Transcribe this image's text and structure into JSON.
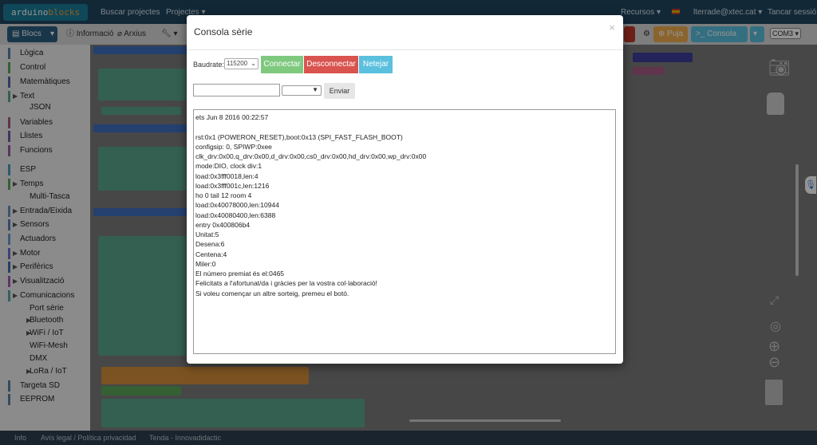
{
  "navbar": {
    "logo_a": "arduino",
    "logo_b": "blocks",
    "links": [
      "Buscar projectes",
      "Projectes ▾"
    ],
    "right": [
      "Recursos ▾",
      "lterrade@xtec.cat ▾",
      "Tancar sessió"
    ]
  },
  "toolbar": {
    "blocs": "Blocs",
    "info": "Informació",
    "arxius": "Arxius",
    "puja": "Puja",
    "consola": "Consola",
    "port": "COM3"
  },
  "categories": [
    {
      "label": "Lògica",
      "color": "#5b80a5",
      "arrow": false
    },
    {
      "label": "Control",
      "color": "#5ba55b",
      "arrow": false
    },
    {
      "label": "Matemàtiques",
      "color": "#5b67a5",
      "arrow": false
    },
    {
      "label": "Text",
      "color": "#5ba58c",
      "arrow": true
    },
    {
      "label": "JSON",
      "color": "",
      "arrow": false,
      "indent": true
    },
    {
      "label": "Variables",
      "color": "#a55b80",
      "arrow": false
    },
    {
      "label": "Llistes",
      "color": "#745ba5",
      "arrow": false
    },
    {
      "label": "Funcions",
      "color": "#995ba5",
      "arrow": false
    },
    {
      "label": "ESP",
      "color": "#4a9bc4",
      "arrow": false
    },
    {
      "label": "Temps",
      "color": "#5ba55b",
      "arrow": true
    },
    {
      "label": "Multi-Tasca",
      "color": "",
      "arrow": false,
      "indent": true
    },
    {
      "label": "Entrada/Eixida",
      "color": "#6a8fbf",
      "arrow": true
    },
    {
      "label": "Sensors",
      "color": "#5a7fbf",
      "arrow": true
    },
    {
      "label": "Actuadors",
      "color": "#6b9bd2",
      "arrow": false
    },
    {
      "label": "Motor",
      "color": "#6f6fd0",
      "arrow": true
    },
    {
      "label": "Perifèrics",
      "color": "#3d6fb0",
      "arrow": true
    },
    {
      "label": "Visualització",
      "color": "#a55bb0",
      "arrow": true
    },
    {
      "label": "Comunicacions",
      "color": "#5ba5a5",
      "arrow": true
    },
    {
      "label": "Port sèrie",
      "color": "",
      "arrow": false,
      "indent": true
    },
    {
      "label": "Bluetooth",
      "color": "",
      "arrow": true,
      "indent": true
    },
    {
      "label": "WiFi / IoT",
      "color": "",
      "arrow": true,
      "indent": true
    },
    {
      "label": "WiFi-Mesh",
      "color": "",
      "arrow": false,
      "indent": true
    },
    {
      "label": "DMX",
      "color": "",
      "arrow": false,
      "indent": true
    },
    {
      "label": "LoRa / IoT",
      "color": "",
      "arrow": true,
      "indent": true
    },
    {
      "label": "Targeta SD",
      "color": "#5b80a5",
      "arrow": false
    },
    {
      "label": "EEPROM",
      "color": "#5b80a5",
      "arrow": false
    }
  ],
  "footer": [
    "Info",
    "Avís legal / Política privacidad",
    "Tenda - Innovadidactic"
  ],
  "modal": {
    "title": "Consola sèrie",
    "close": "×",
    "baud_label": "Baudrate:",
    "baud_value": "115200",
    "connect": "Connectar",
    "disconnect": "Desconnectar",
    "clear": "Netejar",
    "send": "Enviar",
    "send_value": "",
    "output": [
      "ets Jun  8 2016 00:22:57",
      "",
      "rst:0x1 (POWERON_RESET),boot:0x13 (SPI_FAST_FLASH_BOOT)",
      "configsip: 0, SPIWP:0xee",
      "clk_drv:0x00,q_drv:0x00,d_drv:0x00,cs0_drv:0x00,hd_drv:0x00,wp_drv:0x00",
      "mode:DIO, clock div:1",
      "load:0x3fff0018,len:4",
      "load:0x3fff001c,len:1216",
      "ho 0 tail 12 room 4",
      "load:0x40078000,len:10944",
      "load:0x40080400,len:6388",
      "entry 0x400806b4",
      "Unitat:5",
      "Desena:6",
      "Centena:4",
      "Miler:0",
      "El número premiat és el:0465",
      "Felicitats a l'afortunat/da i gràcies per la vostra col·laboració!",
      "Si voleu començar un altre sorteig, premeu el botó."
    ]
  },
  "colors": {
    "connect": "#7fc97f",
    "disconnect": "#d9534f",
    "clear": "#5bc0de",
    "puja": "#f0ad4e",
    "consola": "#5bc0de",
    "navbar": "#20465f"
  }
}
